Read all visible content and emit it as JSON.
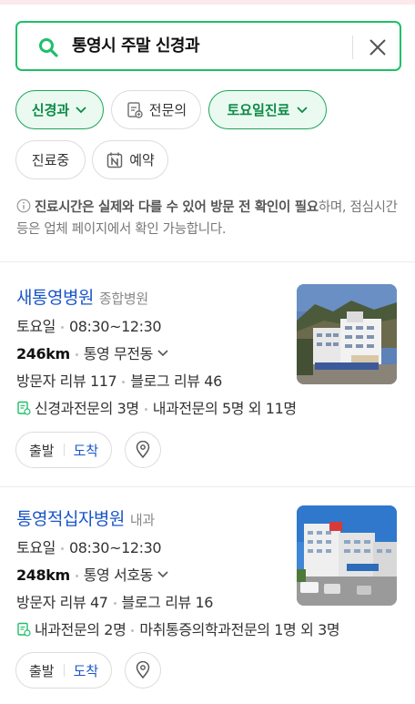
{
  "search": {
    "query": "통영시 주말 신경과"
  },
  "filters": [
    {
      "label": "신경과",
      "active": true,
      "icon": "chevron-down-icon"
    },
    {
      "label": "전문의",
      "active": false,
      "icon": "specialist-doc-icon"
    },
    {
      "label": "토요일진료",
      "active": true,
      "icon": "chevron-down-icon"
    },
    {
      "label": "진료중",
      "active": false
    },
    {
      "label": "예약",
      "active": false,
      "icon": "naver-booking-icon"
    }
  ],
  "notice": {
    "bold": "진료시간은 실제와 다를 수 있어 방문 전 확인이 필요",
    "rest": "하며, 점심시간 등은 업체 페이지에서 확인 가능합니다."
  },
  "results": [
    {
      "name": "새통영병원",
      "category": "종합병원",
      "day": "토요일",
      "hours": "08:30~12:30",
      "distance": "246km",
      "area": "통영 무전동",
      "visitor_reviews": "방문자 리뷰 117",
      "blog_reviews": "블로그 리뷰 46",
      "specialists_a": "신경과전문의 3명",
      "specialists_b": "내과전문의 5명 외 11명",
      "depart": "출발",
      "arrive": "도착"
    },
    {
      "name": "통영적십자병원",
      "category": "내과",
      "day": "토요일",
      "hours": "08:30~12:30",
      "distance": "248km",
      "area": "통영 서호동",
      "visitor_reviews": "방문자 리뷰 47",
      "blog_reviews": "블로그 리뷰 16",
      "specialists_a": "내과전문의 2명",
      "specialists_b": "마취통증의학과전문의 1명 외 3명",
      "depart": "출발",
      "arrive": "도착"
    }
  ],
  "colors": {
    "accent_green": "#1fbf6a",
    "link_blue": "#1a56c9"
  }
}
